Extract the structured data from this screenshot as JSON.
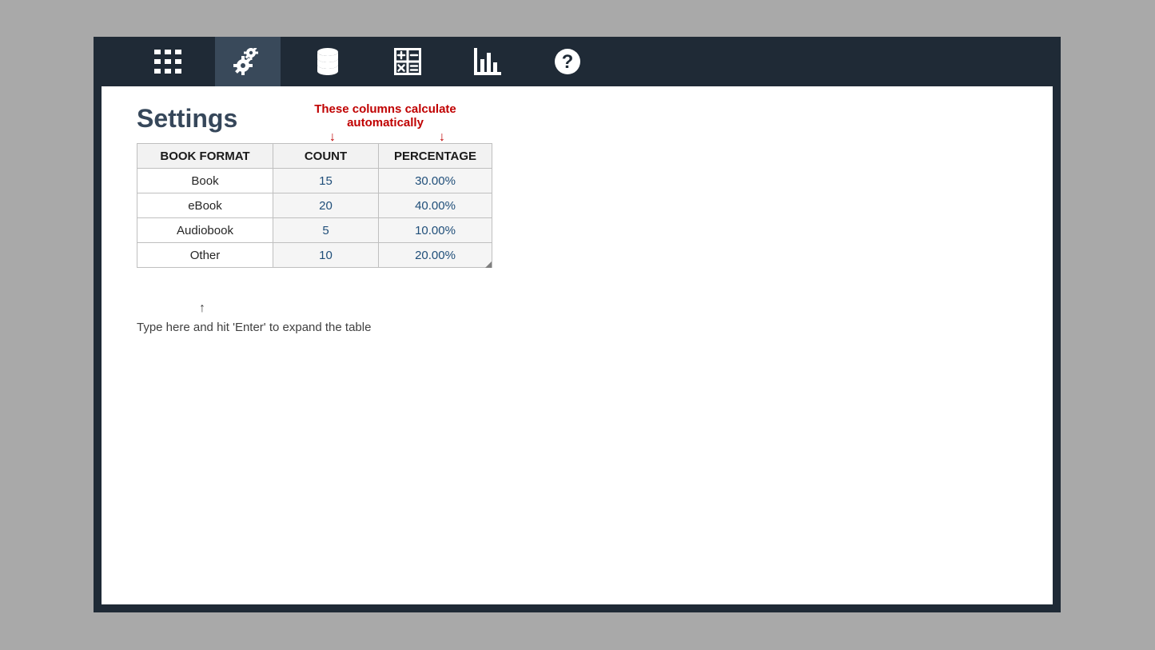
{
  "toolbar": {
    "icons": [
      "apps-icon",
      "settings-icon",
      "data-icon",
      "calc-icon",
      "chart-icon",
      "help-icon"
    ],
    "active_index": 1
  },
  "page": {
    "title": "Settings",
    "hint_text": "These columns calculate automatically",
    "help_text": "Type here and hit 'Enter' to expand the table",
    "down_arrow": "↓",
    "up_arrow": "↑"
  },
  "table": {
    "headers": {
      "format": "BOOK FORMAT",
      "count": "COUNT",
      "percentage": "PERCENTAGE"
    },
    "rows": [
      {
        "format": "Book",
        "count": "15",
        "percentage": "30.00%"
      },
      {
        "format": "eBook",
        "count": "20",
        "percentage": "40.00%"
      },
      {
        "format": "Audiobook",
        "count": "5",
        "percentage": "10.00%"
      },
      {
        "format": "Other",
        "count": "10",
        "percentage": "20.00%"
      }
    ]
  }
}
